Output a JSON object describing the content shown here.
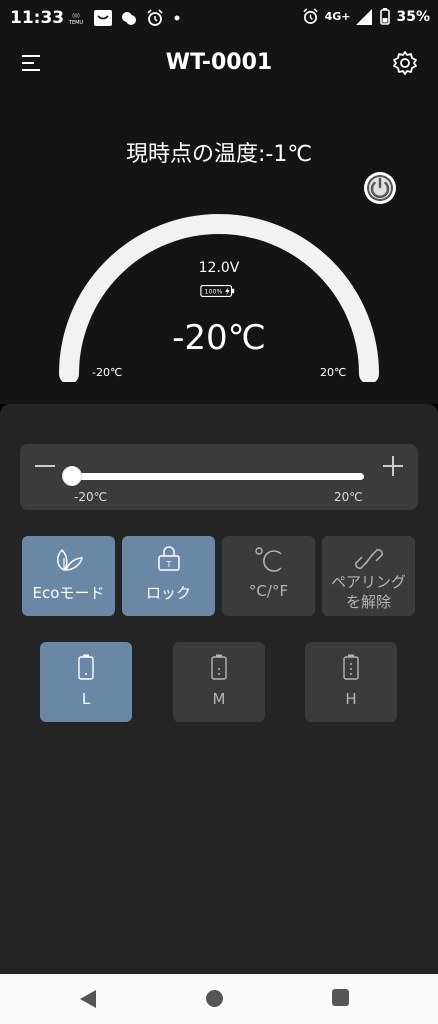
{
  "status_bar": {
    "time": "11:33",
    "left_icons": [
      "temu-icon",
      "mail-icon",
      "weather-icon",
      "alarm-icon",
      "dot-icon"
    ],
    "network": "4G+",
    "battery_percent": "35%"
  },
  "header": {
    "title": "WT-0001",
    "menu_icon": "menu-icon",
    "settings_icon": "gear-icon"
  },
  "hero": {
    "current_temp_label": "現時点の温度:-1℃",
    "voltage": "12.0V",
    "battery_label": "100%",
    "set_temp": "-20℃",
    "gauge_min": "-20℃",
    "gauge_max": "20℃",
    "gauge_level": 0.0
  },
  "slider": {
    "min_label": "-20℃",
    "max_label": "20℃",
    "level": 0.0,
    "decrement_icon": "minus-icon",
    "increment_icon": "plus-icon"
  },
  "modes": [
    {
      "label": "Ecoモード",
      "icon": "leaf-icon",
      "active": true
    },
    {
      "label": "ロック",
      "icon": "lock-icon",
      "active": true
    },
    {
      "label": "°C/°F",
      "icon": "celsius-icon",
      "active": false
    },
    {
      "label": "ペアリング\nを解除",
      "label_line1": "ペアリング",
      "label_line2": "を解除",
      "icon": "unlink-icon",
      "active": false
    }
  ],
  "sizes": [
    {
      "label": "L",
      "icon": "battery-low-icon",
      "active": true
    },
    {
      "label": "M",
      "icon": "battery-mid-icon",
      "active": false
    },
    {
      "label": "H",
      "icon": "battery-high-icon",
      "active": false
    }
  ],
  "colors": {
    "accent": "#6a87a6",
    "panel": "#242424",
    "card": "#3b3b3b"
  }
}
